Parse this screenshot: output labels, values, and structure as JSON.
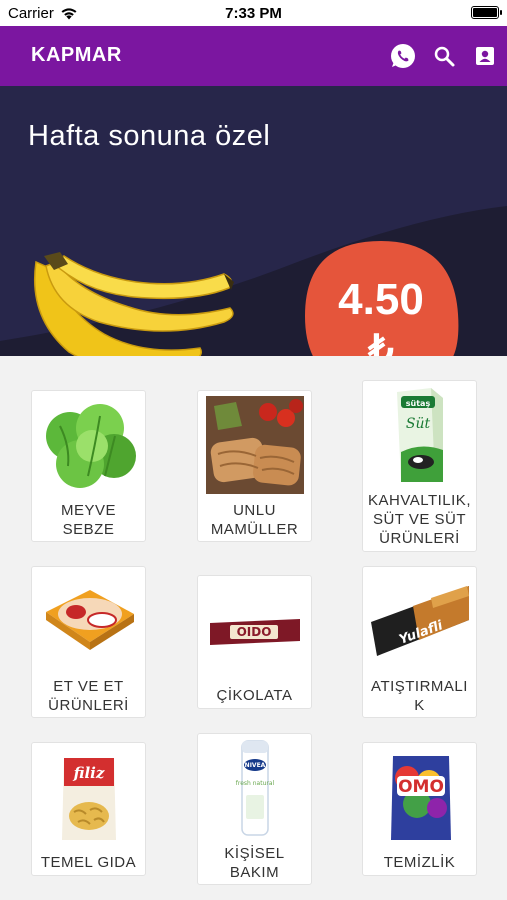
{
  "status": {
    "carrier": "Carrier",
    "time": "7:33 PM"
  },
  "nav": {
    "title": "KAPMAR",
    "icons": [
      "whatsapp-icon",
      "search-icon",
      "contact-card-icon"
    ]
  },
  "banner": {
    "title": "Hafta sonuna özel",
    "price": "4.50",
    "currency": "₺"
  },
  "colors": {
    "nav": "#7b16a0",
    "banner_bg": "#1e1d33",
    "bubble": "#e5553b"
  },
  "categories": [
    {
      "label": "MEYVE\nSEBZE"
    },
    {
      "label": "UNLU\nMAMÜLLER"
    },
    {
      "label": "KAHVALTILIK,\nSÜT VE SÜT\nÜRÜNLERİ"
    },
    {
      "label": "ET VE ET\nÜRÜNLERİ"
    },
    {
      "label": "ÇİKOLATA"
    },
    {
      "label": "ATIŞTIRMALI\nK"
    },
    {
      "label": "TEMEL GIDA"
    },
    {
      "label": "KİŞİSEL\nBAKIM"
    },
    {
      "label": "TEMİZLİK"
    }
  ],
  "product_texts": {
    "chocolate": "OIDO",
    "snack": "Yulafli",
    "pasta": "filiz",
    "nivea": "NIVEA",
    "nivea_sub": "fresh natural",
    "omo": "OMO",
    "milk": "Süt",
    "milk_brand": "sütaş"
  }
}
